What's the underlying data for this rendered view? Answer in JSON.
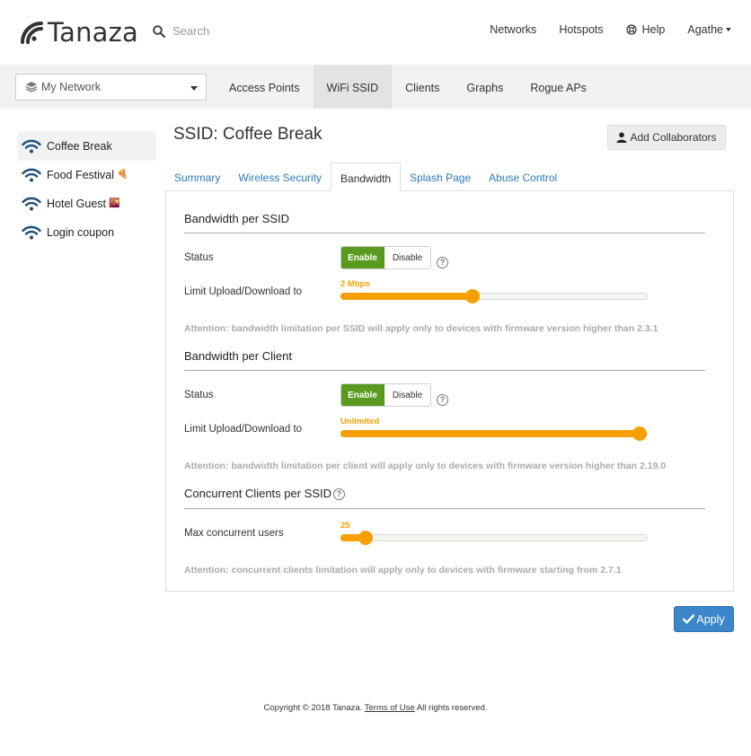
{
  "header": {
    "brand": "Tanaza",
    "search_placeholder": "Search",
    "nav": [
      {
        "label": "Networks"
      },
      {
        "label": "Hotspots"
      },
      {
        "label": "Help"
      },
      {
        "label": "Agathe"
      }
    ]
  },
  "subbar": {
    "network_select": "My Network",
    "tabs": [
      {
        "label": "Access Points"
      },
      {
        "label": "WiFi SSID"
      },
      {
        "label": "Clients"
      },
      {
        "label": "Graphs"
      },
      {
        "label": "Rogue APs"
      }
    ],
    "active_tab": "WiFi SSID"
  },
  "sidebar": {
    "items": [
      {
        "label": "Coffee Break"
      },
      {
        "label": "Food Festival",
        "emoji": "🍕"
      },
      {
        "label": "Hotel Guest",
        "emoji": "🌇"
      },
      {
        "label": "Login coupon"
      }
    ],
    "active": "Coffee Break"
  },
  "main": {
    "title": "SSID: Coffee Break",
    "collab_button": "Add Collaborators",
    "tabs": [
      {
        "label": "Summary"
      },
      {
        "label": "Wireless Security"
      },
      {
        "label": "Bandwidth"
      },
      {
        "label": "Splash Page"
      },
      {
        "label": "Abuse Control"
      }
    ],
    "active_tab": "Bandwidth",
    "sections": {
      "ssid": {
        "title": "Bandwidth per SSID",
        "status_label": "Status",
        "enable": "Enable",
        "disable": "Disable",
        "limit_label": "Limit Upload/Download to",
        "slider_value": "2 Mbps",
        "slider_fraction": 0.44,
        "attention": "Attention: bandwidth limitation per SSID will apply only to devices with firmware version higher than 2.3.1"
      },
      "client": {
        "title": "Bandwidth per Client",
        "status_label": "Status",
        "enable": "Enable",
        "disable": "Disable",
        "limit_label": "Limit Upload/Download to",
        "slider_value": "Unlimited",
        "slider_fraction": 1.0,
        "attention": "Attention: bandwidth limitation per client will apply only to devices with firmware version higher than 2.19.0"
      },
      "concurrent": {
        "title": "Concurrent Clients per SSID",
        "max_label": "Max concurrent users",
        "slider_value": "25",
        "slider_fraction": 0.08,
        "attention": "Attention: concurrent clients limitation will apply only to devices with firmware starting from 2.7.1"
      }
    },
    "apply_button": "Apply"
  },
  "footer": {
    "prefix": "Copyright © 2018 Tanaza.",
    "terms": "Terms of Use",
    "suffix": "All rights reserved."
  },
  "colors": {
    "accent_blue": "#3a86c8",
    "link_blue": "#2a7ab8",
    "enable_green": "#5a9a1e",
    "slider_orange": "#f5a000",
    "wifi_navy": "#1d4f7a"
  }
}
